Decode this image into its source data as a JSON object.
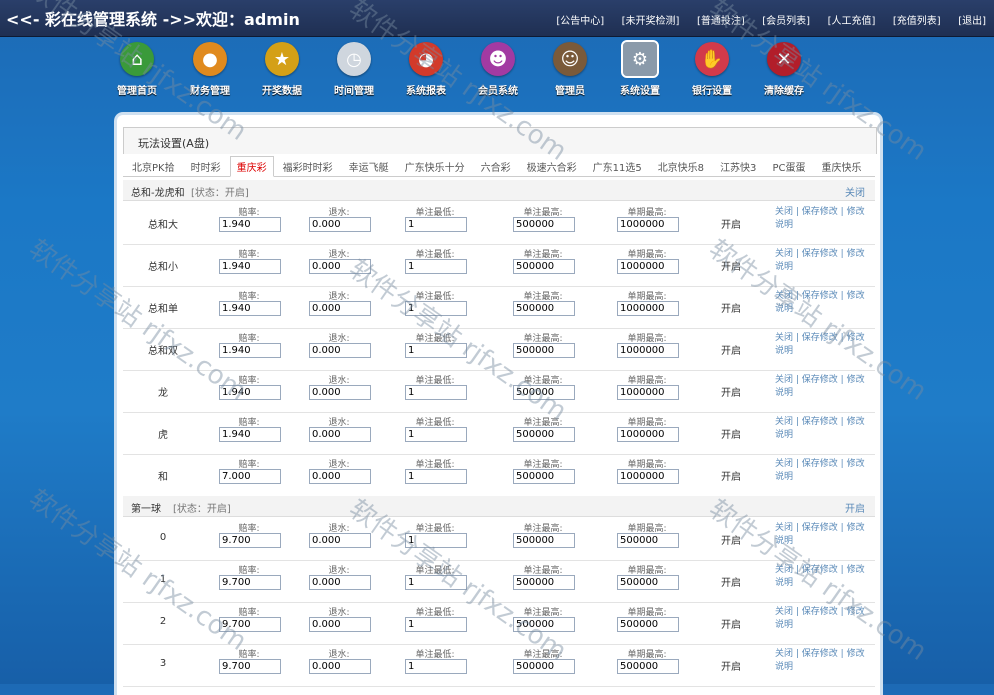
{
  "header": {
    "title": "<<- 彩在线管理系统 ->>欢迎：admin",
    "links": [
      "[公告中心]",
      "[未开奖检测]",
      "[普通投注]",
      "[会员列表]",
      "[人工充值]",
      "[充值列表]",
      "[退出]"
    ]
  },
  "nav": [
    {
      "label": "管理首页",
      "icon": "home-icon",
      "color": "#3a9a3a"
    },
    {
      "label": "财务管理",
      "icon": "money-bag-icon",
      "color": "#e08a1e"
    },
    {
      "label": "开奖数据",
      "icon": "medal-icon",
      "color": "#d4a017"
    },
    {
      "label": "时间管理",
      "icon": "clock-icon",
      "color": "#cfd6de"
    },
    {
      "label": "系统报表",
      "icon": "pie-chart-icon",
      "color": "#d23a2a"
    },
    {
      "label": "会员系统",
      "icon": "users-icon",
      "color": "#a23aa2"
    },
    {
      "label": "管理员",
      "icon": "admin-icon",
      "color": "#7a5a3a"
    },
    {
      "label": "系统设置",
      "icon": "gear-icon",
      "color": "#8a9aaa"
    },
    {
      "label": "银行设置",
      "icon": "bank-hand-icon",
      "color": "#d23a4a"
    },
    {
      "label": "清除缓存",
      "icon": "broom-icon",
      "color": "#b21e2a"
    }
  ],
  "panel": {
    "title": "玩法设置(A盘)",
    "tabs": [
      "北京PK拾",
      "时时彩",
      "重庆彩",
      "福彩时时彩",
      "幸运飞艇",
      "广东快乐十分",
      "六合彩",
      "极速六合彩",
      "广东11选5",
      "北京快乐8",
      "江苏快3",
      "PC蛋蛋",
      "重庆快乐"
    ],
    "active_tab": 2,
    "labels": {
      "odds": "赔率:",
      "rebate": "退水:",
      "min": "单注最低:",
      "max": "单注最高:",
      "period_max": "单期最高:"
    },
    "actions": {
      "close": "关闭",
      "instant": "保存修改",
      "sep": " | ",
      "batch": "修改",
      "note": "说明"
    },
    "sections": [
      {
        "name": "总和-龙虎和",
        "status": "[状态：开启]",
        "action": "关闭",
        "rows": [
          {
            "name": "总和大",
            "odds": "1.940",
            "rebate": "0.000",
            "min": "1",
            "max": "500000",
            "period_max": "1000000",
            "status": "开启"
          },
          {
            "name": "总和小",
            "odds": "1.940",
            "rebate": "0.000",
            "min": "1",
            "max": "500000",
            "period_max": "1000000",
            "status": "开启"
          },
          {
            "name": "总和单",
            "odds": "1.940",
            "rebate": "0.000",
            "min": "1",
            "max": "500000",
            "period_max": "1000000",
            "status": "开启"
          },
          {
            "name": "总和双",
            "odds": "1.940",
            "rebate": "0.000",
            "min": "1",
            "max": "500000",
            "period_max": "1000000",
            "status": "开启"
          },
          {
            "name": "龙",
            "odds": "1.940",
            "rebate": "0.000",
            "min": "1",
            "max": "500000",
            "period_max": "1000000",
            "status": "开启"
          },
          {
            "name": "虎",
            "odds": "1.940",
            "rebate": "0.000",
            "min": "1",
            "max": "500000",
            "period_max": "1000000",
            "status": "开启"
          },
          {
            "name": "和",
            "odds": "7.000",
            "rebate": "0.000",
            "min": "1",
            "max": "500000",
            "period_max": "1000000",
            "status": "开启"
          }
        ]
      },
      {
        "name": "第一球",
        "status": "[状态：开启]",
        "action": "开启",
        "rows": [
          {
            "name": "0",
            "odds": "9.700",
            "rebate": "0.000",
            "min": "1",
            "max": "500000",
            "period_max": "500000",
            "status": "开启"
          },
          {
            "name": "1",
            "odds": "9.700",
            "rebate": "0.000",
            "min": "1",
            "max": "500000",
            "period_max": "500000",
            "status": "开启"
          },
          {
            "name": "2",
            "odds": "9.700",
            "rebate": "0.000",
            "min": "1",
            "max": "500000",
            "period_max": "500000",
            "status": "开启"
          },
          {
            "name": "3",
            "odds": "9.700",
            "rebate": "0.000",
            "min": "1",
            "max": "500000",
            "period_max": "500000",
            "status": "开启"
          }
        ]
      }
    ]
  },
  "watermark": [
    "软件分享站 rjfxz.com"
  ]
}
